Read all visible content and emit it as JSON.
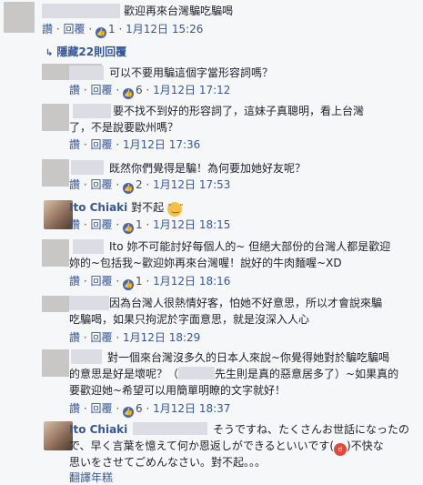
{
  "actions": {
    "like": "讚",
    "reply": "回覆",
    "sep": "·"
  },
  "hidden_replies": "隱藏22則回覆",
  "comments": [
    {
      "text1": "歡迎再來台灣騙吃騙喝",
      "likes": "1",
      "time": "1月12日 15:26"
    },
    {
      "text1": "可以不要用騙這個字當形容詞嗎？",
      "likes": "6",
      "time": "1月12日 17:12"
    },
    {
      "text1": "要不找不到好的形容詞了，這妹子真聰明，看上台灣",
      "text2": "了，不是說要歐州嗎？",
      "time": "1月12日 17:36"
    },
    {
      "text1": "既然你們覺得是騙！為何要加她好友呢？",
      "likes": "2",
      "time": "1月12日 17:53"
    },
    {
      "name": "Ito Chiaki",
      "text1": "對不起",
      "likes": "1",
      "time": "1月12日 18:15"
    },
    {
      "text1": "Ito 妳不可能討好每個人的~ 但絕大部份的台灣人都是歡迎",
      "text2": "妳的~包括我~歡迎妳再來台灣喔！說好的牛肉麵喔~XD",
      "likes": "1",
      "time": "1月12日 18:16"
    },
    {
      "text1": "因為台灣人很熱情好客，怕她不好意思，所以才會說來騙",
      "text2": "吃騙喝，如果只拘泥於字面意思，就是沒深入人心",
      "time": "1月12日 18:29"
    },
    {
      "text1": "對一個來台灣沒多久的日本人來說~你覺得她對於騙吃騙喝",
      "text2": "的意思是好是壞呢？（",
      "text2b": "先生則是真的惡意居多了）~如果真的",
      "text3": "要歡迎她~希望可以用簡單明瞭的文字就好！",
      "likes": "6",
      "time": "1月12日 18:37"
    },
    {
      "name": "Ito Chiaki",
      "text1": "そうですね、たくさんお世話になったの",
      "text2": "で、早く言葉を憶えて何か恩返しができるといいです",
      "text2b": "不快な",
      "text3": "思いをさせてごめんなさい。對不起。。。",
      "translate": "翻譯年糕"
    }
  ]
}
